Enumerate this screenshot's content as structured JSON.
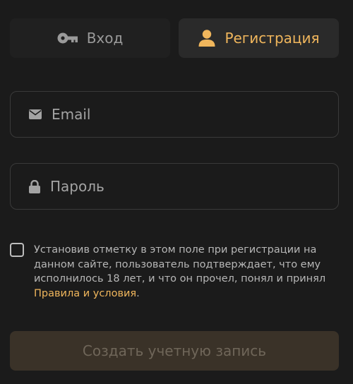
{
  "tabs": {
    "login": {
      "label": "Вход",
      "icon": "key-icon"
    },
    "register": {
      "label": "Регистрация",
      "icon": "user-icon",
      "active": true
    }
  },
  "form": {
    "email": {
      "placeholder": "Email",
      "icon": "envelope-icon"
    },
    "password": {
      "placeholder": "Пароль",
      "icon": "lock-icon"
    }
  },
  "consent": {
    "text": "Установив отметку в этом поле при регистрации на данном сайте, пользователь подтверждает, что ему исполнилось 18 лет, и что он прочел, понял и принял ",
    "link": "Правила и условия",
    "suffix": ".",
    "checked": false
  },
  "submit": {
    "label": "Создать учетную запись",
    "enabled": false
  },
  "colors": {
    "background": "#1b1b1b",
    "accent": "#f0b65c",
    "field_border": "#3a3a3a",
    "submit_bg": "#3a3228"
  }
}
